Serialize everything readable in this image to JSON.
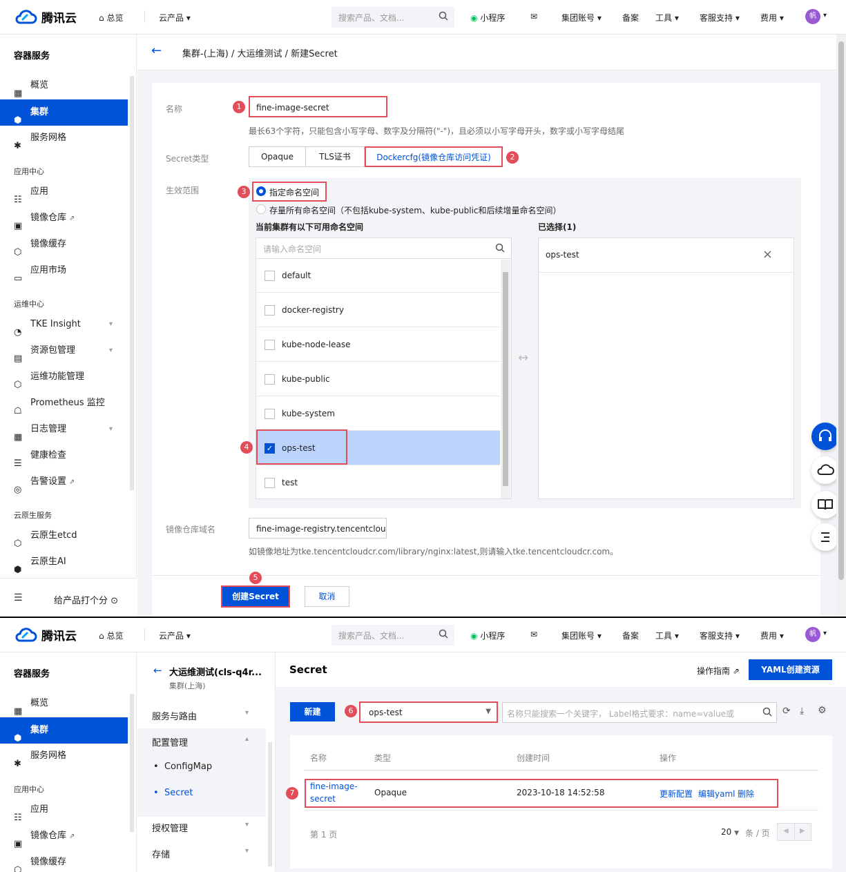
{
  "topbar": {
    "brand": "腾讯云",
    "overview": "总览",
    "products": "云产品",
    "search_placeholder": "搜索产品、文档...",
    "miniprogram": "小程序",
    "group_account": "集团账号",
    "beian": "备案",
    "tools": "工具",
    "support": "客服支持",
    "billing": "费用",
    "avatar_text": "帆"
  },
  "sidebar": {
    "title": "容器服务",
    "items": [
      "概览",
      "集群",
      "服务网格"
    ],
    "group_app": "应用中心",
    "app_items": [
      "应用",
      "镜像仓库",
      "镜像缓存",
      "应用市场"
    ],
    "group_ops": "运维中心",
    "ops_items": [
      "TKE Insight",
      "资源包管理",
      "运维功能管理",
      "Prometheus 监控",
      "日志管理",
      "健康检查",
      "告警设置"
    ],
    "group_native": "云原生服务",
    "native_items": [
      "云原生etcd",
      "云原生AI"
    ],
    "feedback": "给产品打个分"
  },
  "breadcrumb": "集群-(上海)  /  大运维测试  /  新建Secret",
  "form": {
    "name_label": "名称",
    "name_value": "fine-image-secret",
    "name_help": "最长63个字符，只能包含小写字母、数字及分隔符(\"-\")，且必须以小写字母开头，数字或小写字母结尾",
    "type_label": "Secret类型",
    "types": [
      "Opaque",
      "TLS证书",
      "Dockercfg(镜像仓库访问凭证)"
    ],
    "scope_label": "生效范围",
    "scope_opt1": "指定命名空间",
    "scope_opt2": "存量所有命名空间（不包括kube-system、kube-public和后续增量命名空间）",
    "available_title": "当前集群有以下可用命名空间",
    "selected_title": "已选择(1)",
    "ns_search_placeholder": "请输入命名空间",
    "namespaces": [
      "default",
      "docker-registry",
      "kube-node-lease",
      "kube-public",
      "kube-system",
      "ops-test",
      "test"
    ],
    "selected": [
      "ops-test"
    ],
    "registry_label": "镜像仓库域名",
    "registry_value": "fine-image-registry.tencentcloudc",
    "registry_help": "如镜像地址为tke.tencentcloudcr.com/library/nginx:latest,则请输入tke.tencentcloudcr.com。",
    "submit": "创建Secret",
    "cancel": "取消"
  },
  "badges": [
    "1",
    "2",
    "3",
    "4",
    "5",
    "6",
    "7"
  ],
  "screen2": {
    "cluster_name": "大运维测试(cls-q4r...",
    "cluster_region": "集群(上海)",
    "nav": [
      "服务与路由",
      "配置管理",
      "ConfigMap",
      "Secret",
      "授权管理",
      "存储"
    ],
    "page_title": "Secret",
    "guide": "操作指南",
    "yaml_btn": "YAML创建资源",
    "new_btn": "新建",
    "namespace_select": "ops-test",
    "search_placeholder": "名称只能搜索一个关键字， Label格式要求：name=value或",
    "columns": [
      "名称",
      "类型",
      "创建时间",
      "操作"
    ],
    "row": {
      "name_line1": "fine-image-",
      "name_line2": "secret",
      "type": "Opaque",
      "created": "2023-10-18 14:52:58",
      "actions": [
        "更新配置",
        "编辑yaml",
        "删除"
      ]
    },
    "page_info": "第 1 页",
    "page_size": "20",
    "per_page": "条 / 页"
  },
  "colors": {
    "primary": "#0052d9",
    "annotation_red": "#e34d59"
  }
}
